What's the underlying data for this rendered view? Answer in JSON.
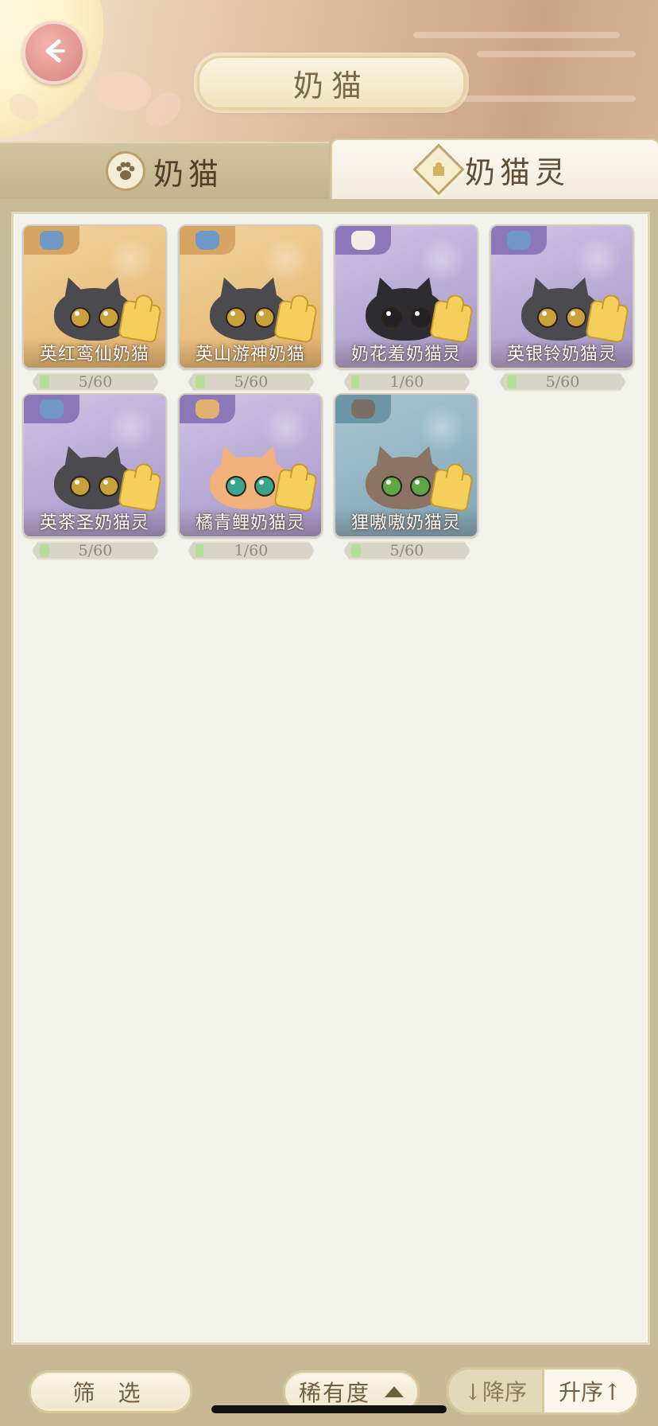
{
  "header": {
    "title": "奶猫"
  },
  "tabs": [
    {
      "label": "奶猫",
      "active": false
    },
    {
      "label": "奶猫灵",
      "active": true
    }
  ],
  "cards": [
    {
      "name": "英红鸾仙奶猫",
      "progress": "5/60",
      "rarity": "gold",
      "fill": 0.0833,
      "icon_color": "#6f99c4",
      "cat_color": "#4a4a4f",
      "eye_color": "#c9a13a"
    },
    {
      "name": "英山游神奶猫",
      "progress": "5/60",
      "rarity": "gold",
      "fill": 0.0833,
      "icon_color": "#6f99c4",
      "cat_color": "#4a4a4f",
      "eye_color": "#c9a13a"
    },
    {
      "name": "奶花羞奶猫灵",
      "progress": "1/60",
      "rarity": "purple",
      "fill": 0.0167,
      "icon_color": "#f3efe6",
      "cat_color": "#2d2d31",
      "eye_color": "#222222"
    },
    {
      "name": "英银铃奶猫灵",
      "progress": "5/60",
      "rarity": "purple",
      "fill": 0.0833,
      "icon_color": "#6f99c4",
      "cat_color": "#4a4a4f",
      "eye_color": "#c9a13a"
    },
    {
      "name": "英茶圣奶猫灵",
      "progress": "5/60",
      "rarity": "purple",
      "fill": 0.0833,
      "icon_color": "#6f99c4",
      "cat_color": "#4a4a4f",
      "eye_color": "#c9a13a"
    },
    {
      "name": "橘青鲤奶猫灵",
      "progress": "1/60",
      "rarity": "purple",
      "fill": 0.0167,
      "icon_color": "#e2b16f",
      "cat_color": "#f0b27a",
      "eye_color": "#3aa58c"
    },
    {
      "name": "狸嗷嗷奶猫灵",
      "progress": "5/60",
      "rarity": "blue",
      "fill": 0.0833,
      "icon_color": "#7a6f66",
      "cat_color": "#8b7464",
      "eye_color": "#5ca848"
    }
  ],
  "bottom": {
    "filter_label": "筛 选",
    "sort_field_label": "稀有度",
    "desc_label": "↓降序",
    "asc_label": "升序↑"
  },
  "colors": {
    "panel_bg": "#f3f3ee",
    "accent_gold": "#c7b993",
    "progress_fill": "#b5dd97"
  }
}
